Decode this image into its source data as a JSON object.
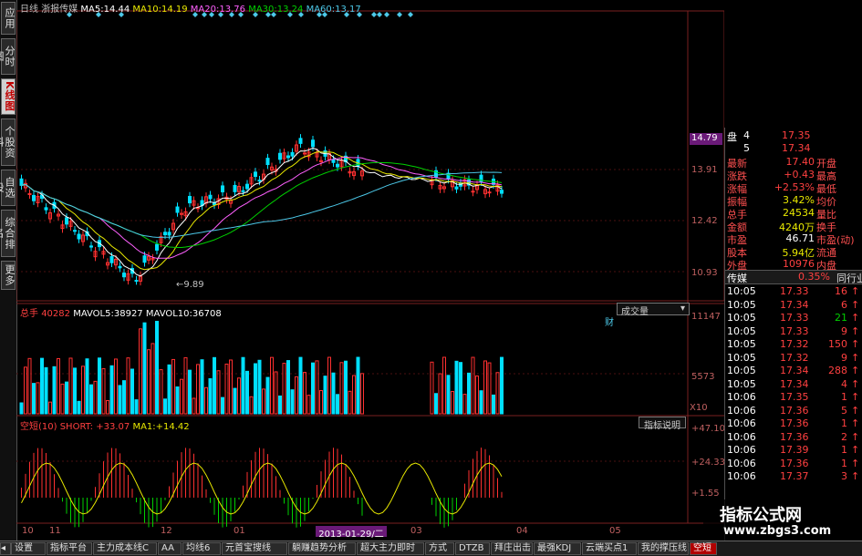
{
  "sidebar": {
    "tabs": [
      "应用",
      "分时图",
      "K线图",
      "个股资料",
      "自选股",
      "综合排名",
      "更多"
    ],
    "active_index": 2
  },
  "header": {
    "period": "日线",
    "stock": "浙报传媒",
    "ma5_label": "MA5:",
    "ma5": "14.44",
    "ma10_label": "MA10:",
    "ma10": "14.19",
    "ma20_label": "MA20:",
    "ma20": "13.76",
    "ma30_label": "MA30:",
    "ma30": "13.24",
    "ma60_label": "MA60:",
    "ma60": "13.17"
  },
  "price_axis": {
    "current": "14.79",
    "ticks": [
      "13.91",
      "12.42",
      "10.93"
    ],
    "low_marker": "9.89",
    "cai": "财"
  },
  "volume": {
    "label": "总手",
    "value": "40282",
    "mavol5_label": "MAVOL5:",
    "mavol5": "38927",
    "mavol10_label": "MAVOL10:",
    "mavol10": "36708",
    "dropdown": "成交量",
    "ticks": [
      "11147",
      "5573",
      "X10"
    ]
  },
  "indicator": {
    "label": "空短(10) SHORT:",
    "short": "+33.07",
    "ma1_label": "MA1:",
    "ma1": "+14.42",
    "button": "指标说明",
    "ticks": [
      "+47.10",
      "+24.33",
      "+1.55"
    ]
  },
  "date_axis": {
    "labels": [
      "10",
      "11",
      "12",
      "01",
      "03",
      "04",
      "05"
    ],
    "highlight": "2013-01-29/二"
  },
  "quote_panel": {
    "ask_rows": [
      {
        "label": "盘",
        "vol": "4",
        "price": "17.35"
      },
      {
        "label": "",
        "vol": "5",
        "price": "17.34"
      }
    ],
    "rows": [
      {
        "l1": "最新",
        "v1": "17.40",
        "l2": "开盘",
        "c": "red"
      },
      {
        "l1": "涨跌",
        "v1": "+0.43",
        "l2": "最高",
        "c": "red"
      },
      {
        "l1": "涨幅",
        "v1": "+2.53%",
        "l2": "最低",
        "c": "red"
      },
      {
        "l1": "振幅",
        "v1": "3.42%",
        "l2": "均价",
        "c": "yel"
      },
      {
        "l1": "总手",
        "v1": "24534",
        "l2": "量比",
        "c": "yel"
      },
      {
        "l1": "金额",
        "v1": "4240万",
        "l2": "换手",
        "c": "yel"
      },
      {
        "l1": "市盈",
        "v1": "46.71",
        "l2": "市盈(动)",
        "c": "wht"
      },
      {
        "l1": "股本",
        "v1": "5.94亿",
        "l2": "流通",
        "c": "yel"
      },
      {
        "l1": "外盘",
        "v1": "10976",
        "l2": "内盘",
        "c": "red"
      }
    ],
    "industry": {
      "name": "传媒",
      "pct": "0.35%",
      "tab": "同行业"
    },
    "ticks": [
      {
        "t": "10:05",
        "p": "17.33",
        "v": "16",
        "d": "up"
      },
      {
        "t": "10:05",
        "p": "17.34",
        "v": "6",
        "d": "up"
      },
      {
        "t": "10:05",
        "p": "17.33",
        "v": "21",
        "d": "up"
      },
      {
        "t": "10:05",
        "p": "17.33",
        "v": "9",
        "d": "up"
      },
      {
        "t": "10:05",
        "p": "17.32",
        "v": "150",
        "d": "up"
      },
      {
        "t": "10:05",
        "p": "17.32",
        "v": "9",
        "d": "up"
      },
      {
        "t": "10:05",
        "p": "17.34",
        "v": "288",
        "d": "up"
      },
      {
        "t": "10:05",
        "p": "17.34",
        "v": "4",
        "d": "up"
      },
      {
        "t": "10:06",
        "p": "17.35",
        "v": "1",
        "d": "up"
      },
      {
        "t": "10:06",
        "p": "17.36",
        "v": "5",
        "d": "up"
      },
      {
        "t": "10:06",
        "p": "17.36",
        "v": "1",
        "d": "up"
      },
      {
        "t": "10:06",
        "p": "17.36",
        "v": "2",
        "d": "up"
      },
      {
        "t": "10:06",
        "p": "17.39",
        "v": "1",
        "d": "up"
      },
      {
        "t": "10:06",
        "p": "17.36",
        "v": "1",
        "d": "up"
      },
      {
        "t": "10:06",
        "p": "17.37",
        "v": "3",
        "d": "up"
      }
    ]
  },
  "bottom_tabs": [
    "设置",
    "指标平台",
    "主力成本线C",
    "AA",
    "均线6",
    "元首宝搜线",
    "躺赚趋势分析",
    "超大主力即时",
    "方式",
    "DTZB",
    "拜庄出击",
    "最强KDJ",
    "云端买点1",
    "我的撑压线",
    "空短"
  ],
  "watermark": {
    "title": "指标公式网",
    "url": "www.zbgs3.com"
  },
  "colors": {
    "up": "#ff3030",
    "down": "#00e0ff",
    "ma5": "#ffffff",
    "ma10": "#e8e800",
    "ma20": "#ff60ff",
    "ma30": "#00d000",
    "ma60": "#4cc8e8",
    "accent": "#6a1a78"
  }
}
